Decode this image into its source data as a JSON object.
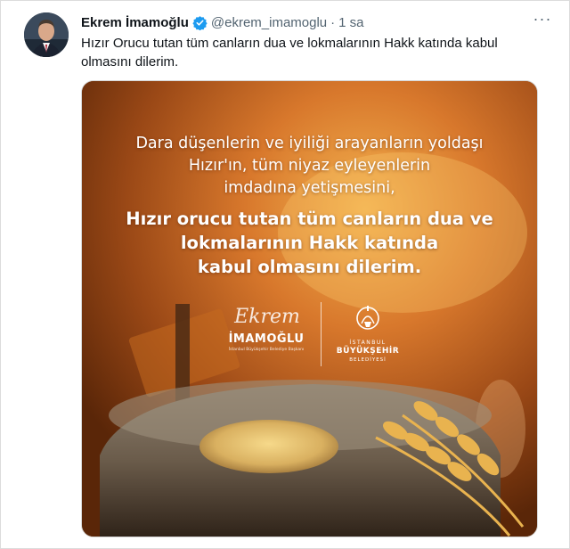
{
  "tweet": {
    "author_name": "Ekrem İmamoğlu",
    "handle": "@ekrem_imamoglu",
    "separator": "·",
    "time": "1 sa",
    "more_label": "···",
    "text": "Hızır Orucu tutan tüm canların dua ve lokmalarının Hakk katında kabul olmasını dilerim."
  },
  "media": {
    "quote_lines": [
      "Dara düşenlerin ve iyiliği arayanların yoldaşı",
      "Hızır'ın, tüm niyaz eyleyenlerin",
      "imdadına yetişmesini,"
    ],
    "quote_bold_lines": [
      "Hızır orucu tutan tüm canların dua ve",
      "lokmalarının Hakk katında",
      "kabul olmasını dilerim."
    ],
    "signature_script": "Ekrem",
    "signature_name": "İMAMOĞLU",
    "signature_subtitle": "İstanbul Büyükşehir Belediye Başkanı",
    "ibb_line1": "İSTANBUL",
    "ibb_line2": "BÜYÜKŞEHİR",
    "ibb_line3": "BELEDİYESİ"
  },
  "icons": {
    "verified": "verified-badge-icon",
    "more": "more-options-icon"
  },
  "colors": {
    "verified_blue": "#1d9bf0",
    "secondary_text": "#536471",
    "primary_text": "#0f1419"
  }
}
